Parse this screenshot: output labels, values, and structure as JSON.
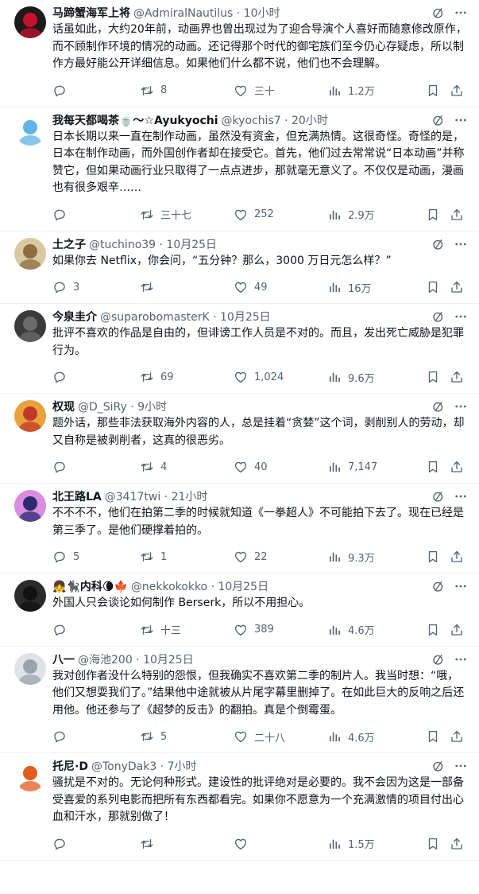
{
  "tweets": [
    {
      "name": "马蹄蟹海军上将",
      "handle_time": "@AdmiralNautilus · 10小时",
      "text": "话虽如此，大约20年前，动画界也曾出现过为了迎合导演个人喜好而随意修改原作，而不顾制作环境的情况的动画。还记得那个时代的御宅族们至今仍心存疑虑，所以制作方最好能公开详细信息。如果他们什么都不说，他们也不会理解。",
      "reply": "",
      "retweet": "8",
      "like": "三十",
      "views": "1.2万",
      "avatar": {
        "bg": "#1b1b1b",
        "fg": "#c8102e",
        "icon": "dark-red-avatar-icon"
      }
    },
    {
      "name": "我每天都喝茶🍵〜☆Ayukyochi",
      "handle_time": "@kyochis7 · 20小时",
      "text": "日本长期以来一直在制作动画，虽然没有资金，但充满热情。这很奇怪。奇怪的是，日本在制作动画，而外国创作者却在接受它。首先，他们过去常常说“日本动画”并称赞它，但如果动画行业只取得了一点点进步，那就毫无意义了。不仅仅是动画，漫画也有很多艰辛……",
      "reply": "",
      "retweet": "三十七",
      "like": "252",
      "views": "2.9万",
      "avatar": {
        "bg": "#ffffff",
        "fg": "#5fb3e6",
        "icon": "blue-creature-avatar-icon"
      }
    },
    {
      "name": "土之子",
      "handle_time": "@tuchino39 · 10月25日",
      "text": "如果你去 Netflix，你会问，“五分钟？那么，3000 万日元怎么样？”",
      "reply": "3",
      "retweet": "",
      "like": "49",
      "views": "16万",
      "avatar": {
        "bg": "#d9c9a3",
        "fg": "#8c6d3f",
        "icon": "cat-avatar-icon"
      }
    },
    {
      "name": "今泉圭介",
      "handle_time": "@suparobomasterK · 10月25日",
      "text": "批评不喜欢的作品是自由的，但诽谤工作人员是不对的。而且，发出死亡威胁是犯罪行为。",
      "reply": "",
      "retweet": "69",
      "like": "1,024",
      "views": "9.6万",
      "avatar": {
        "bg": "#3a3a3a",
        "fg": "#6b6b6b",
        "icon": "dark-photo-avatar-icon"
      }
    },
    {
      "name": "权现",
      "handle_time": "@D_SiRy · 9小时",
      "text": "题外话，那些非法获取海外内容的人，总是挂着“贪婪”这个词，剥削别人的劳动，却又自称是被剥削者，这真的很恶劣。",
      "reply": "",
      "retweet": "4",
      "like": "40",
      "views": "7,147",
      "avatar": {
        "bg": "#e8a23c",
        "fg": "#c0392b",
        "icon": "colorful-art-avatar-icon"
      }
    },
    {
      "name": "北王路LA",
      "handle_time": "@3417twi · 21小时",
      "text": "不不不不，他们在拍第二季的时候就知道《一拳超人》不可能拍下去了。现在已经是第三季了。是他们硬撑着拍的。",
      "reply": "5",
      "retweet": "1",
      "like": "22",
      "views": "9.3万",
      "avatar": {
        "bg": "#d98ce0",
        "fg": "#2a2a6e",
        "icon": "smiling-face-avatar-icon"
      }
    },
    {
      "name": "👧🐈‍⬛内科🌘🍁",
      "handle_time": "@nekkokokko · 10月25日",
      "text": "外国人只会谈论如何制作 Berserk，所以不用担心。",
      "reply": "",
      "retweet": "十三",
      "like": "389",
      "views": "4.6万",
      "avatar": {
        "bg": "#2b2b2b",
        "fg": "#111111",
        "icon": "black-cat-avatar-icon"
      }
    },
    {
      "name": "八一",
      "handle_time": "@海池200 · 10月25日",
      "text": "我对创作者没什么特别的怨恨，但我确实不喜欢第二季的制片人。我当时想：“哦，他们又想耍我们了。”结果他中途就被从片尾字幕里删掉了。在如此巨大的反响之后还用他。他还参与了《超梦的反击》的翻拍。真是个倒霉蛋。",
      "reply": "",
      "retweet": "5",
      "like": "二十八",
      "views": "4.6万",
      "avatar": {
        "bg": "#dfe3e8",
        "fg": "#9aa3ad",
        "icon": "anime-character-avatar-icon"
      }
    },
    {
      "name": "托尼·D",
      "handle_time": "@TonyDak3 · 7小时",
      "text": "骚扰是不对的。无论何种形式。建设性的批评绝对是必要的。我不会因为这是一部备受喜爱的系列电影而把所有东西都看完。如果你不愿意为一个充满激情的项目付出心血和汗水，那就别做了！",
      "reply": "",
      "retweet": "",
      "like": "",
      "views": "1.5万",
      "avatar": {
        "bg": "#ffffff",
        "fg": "#e35b1f",
        "icon": "orange-figure-avatar-icon"
      }
    }
  ]
}
